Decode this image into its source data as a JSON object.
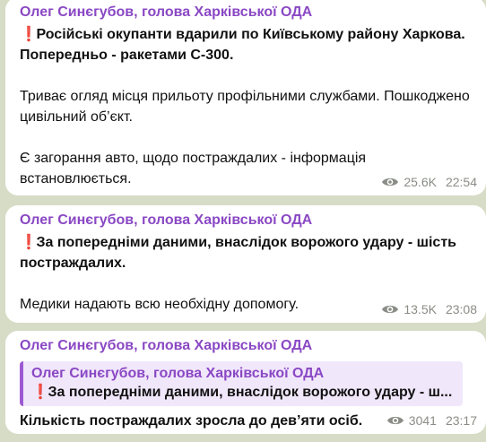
{
  "colors": {
    "background": "#d6dcc6",
    "bubble": "#ffffff",
    "sender": "#8a48c4",
    "exclamation": "#e0322b",
    "meta": "#8a8d86",
    "reply_bg": "#f1e7fb",
    "reply_bar": "#9c59d1"
  },
  "icons": {
    "exclamation": "❗",
    "views": "eye-icon"
  },
  "messages": [
    {
      "sender": "Олег Синєгубов, голова Харківської ОДА",
      "headline": "Російські окупанти вдарили по Київському району Харкова. Попередньо - ракетами С-300.",
      "paragraphs": [
        "Триває огляд місця прильоту профільними службами. Пошкоджено цивільний об’єкт.",
        "Є загорання авто, щодо постраждалих - інформація встановлюється."
      ],
      "views": "25.6K",
      "time": "22:54"
    },
    {
      "sender": "Олег Синєгубов, голова Харківської ОДА",
      "headline": "За попередніми даними, внаслідок ворожого удару - шість постраждалих.",
      "paragraphs": [
        "Медики надають всю необхідну допомогу."
      ],
      "views": "13.5K",
      "time": "23:08"
    },
    {
      "sender": "Олег Синєгубов, голова Харківської ОДА",
      "reply": {
        "sender": "Олег Синєгубов, голова Харківської ОДА",
        "text": "За попередніми даними, внаслідок ворожого удару - ш..."
      },
      "text": "Кількість постраждалих зросла до дев’яти осіб.",
      "views": "3041",
      "time": "23:17"
    }
  ]
}
